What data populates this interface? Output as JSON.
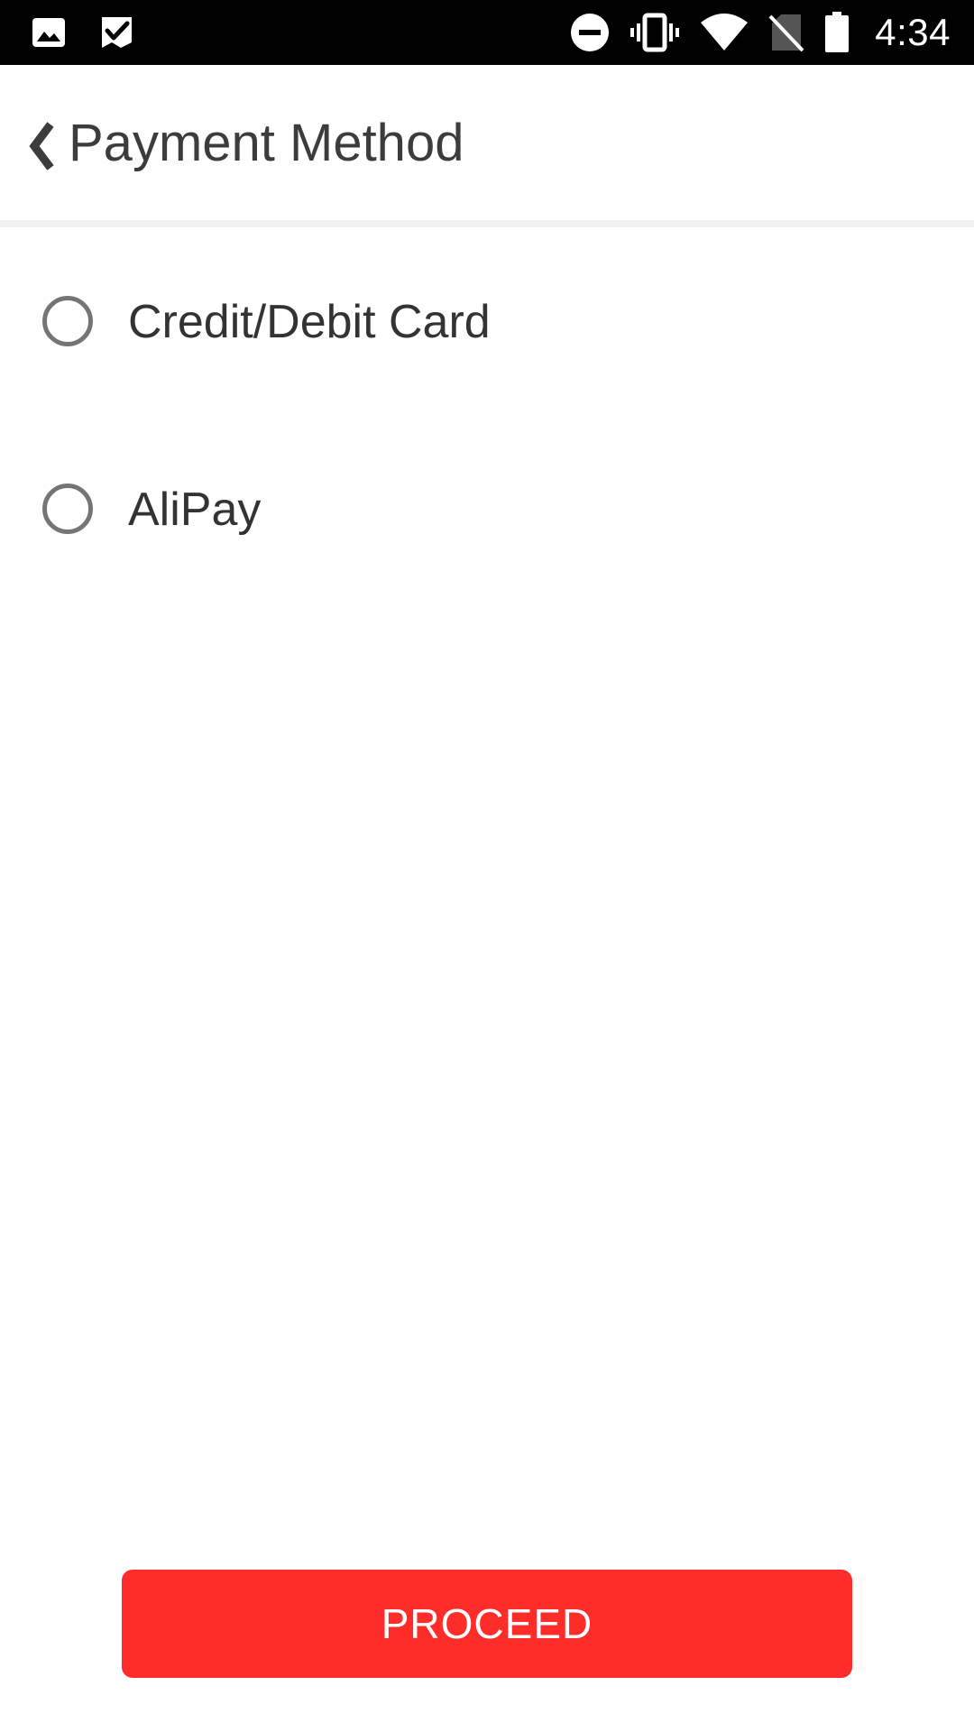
{
  "status_bar": {
    "time": "4:34",
    "left_icons": [
      "image-icon",
      "check-flag-icon"
    ],
    "right_icons": [
      "do-not-disturb-icon",
      "vibrate-icon",
      "wifi-icon",
      "no-sim-icon",
      "battery-icon"
    ]
  },
  "header": {
    "back_icon": "chevron-left-icon",
    "title": "Payment Method"
  },
  "payment_options": [
    {
      "label": "Credit/Debit Card",
      "selected": false
    },
    {
      "label": "AliPay",
      "selected": false
    }
  ],
  "footer": {
    "proceed_label": "PROCEED"
  },
  "colors": {
    "status_bar_bg": "#000000",
    "title_text": "#3c3c3c",
    "option_text": "#333333",
    "radio_border": "#757575",
    "divider": "#f1f1f3",
    "primary_button": "#ff2d2a",
    "button_text": "#ffffff"
  }
}
